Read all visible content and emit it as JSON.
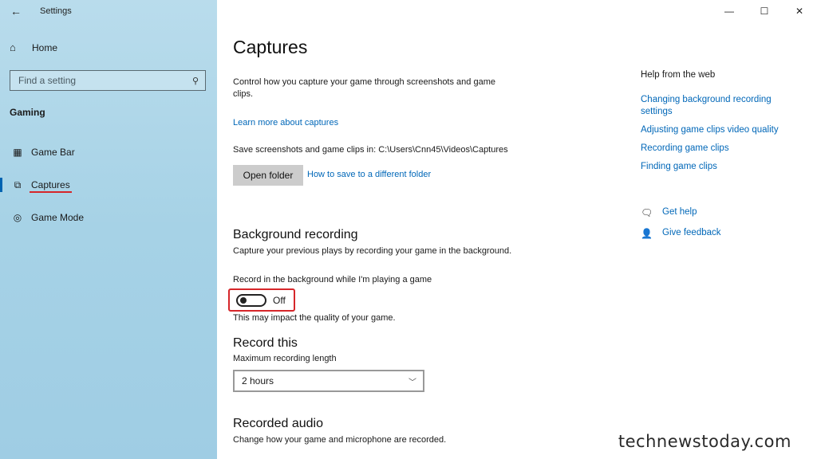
{
  "window": {
    "title": "Settings"
  },
  "sidebar": {
    "home_label": "Home",
    "search_placeholder": "Find a setting",
    "section": "Gaming",
    "items": [
      {
        "label": "Game Bar",
        "icon": "game-bar-icon"
      },
      {
        "label": "Captures",
        "icon": "captures-icon",
        "selected": true
      },
      {
        "label": "Game Mode",
        "icon": "game-mode-icon"
      }
    ]
  },
  "main": {
    "title": "Captures",
    "intro_line1": "Control how you capture your game through screenshots and game",
    "intro_line2": "clips.",
    "learn_more": "Learn more about captures",
    "save_location": "Save screenshots and game clips in: C:\\Users\\Cnn45\\Videos\\Captures",
    "open_folder": "Open folder",
    "how_to_save": "How to save to a different folder",
    "background": {
      "heading": "Background recording",
      "desc": "Capture your previous plays by recording your game in the background.",
      "toggle_label": "Record in the background while I'm playing a game",
      "toggle_state": "Off",
      "note": "This may impact the quality of your game."
    },
    "record_this": {
      "heading": "Record this",
      "label": "Maximum recording length",
      "value": "2 hours"
    },
    "audio": {
      "heading": "Recorded audio",
      "desc": "Change how your game and microphone are recorded."
    }
  },
  "help": {
    "heading": "Help from the web",
    "link1_line1": "Changing background recording",
    "link1_line2": "settings",
    "link2": "Adjusting game clips video quality",
    "link3": "Recording game clips",
    "link4": "Finding game clips",
    "get_help": "Get help",
    "give_feedback": "Give feedback"
  },
  "watermark": "technewstoday.com"
}
